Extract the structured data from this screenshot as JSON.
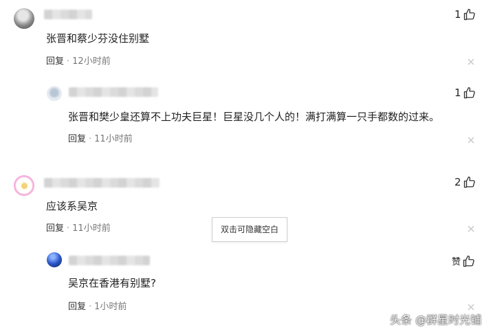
{
  "comments": [
    {
      "text": "张晋和蔡少芬没住别墅",
      "reply_label": "回复",
      "separator": "·",
      "time": "12小时前",
      "likes": "1",
      "replies": [
        {
          "text": "张晋和樊少皇还算不上功夫巨星！巨星没几个人的！满打满算一只手都数的过来。",
          "reply_label": "回复",
          "separator": "·",
          "time": "11小时前",
          "likes": "1"
        }
      ]
    },
    {
      "text": "应该系吴京",
      "reply_label": "回复",
      "separator": "·",
      "time": "11小时前",
      "likes": "2",
      "replies": [
        {
          "text": "吴京在香港有别墅?",
          "reply_label": "回复",
          "separator": "·",
          "time": "1小时前",
          "likes": "赞"
        }
      ]
    }
  ],
  "tooltip": "双击可隐藏空白",
  "watermark": "头条 @群星时光铺",
  "icons": {
    "like": "thumbs-up-icon",
    "close": "close-icon"
  },
  "colors": {
    "text": "#222222",
    "meta": "#777777",
    "close": "#c8c8c8"
  }
}
